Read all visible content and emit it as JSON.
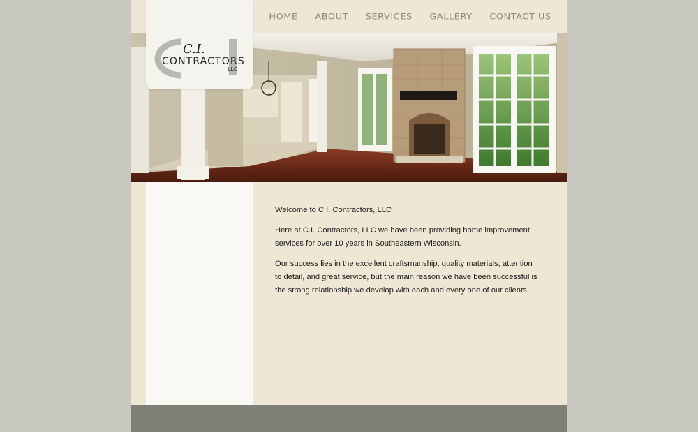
{
  "nav": {
    "items": [
      "HOME",
      "ABOUT",
      "SERVICES",
      "GALLERY",
      "CONTACT US"
    ]
  },
  "logo": {
    "line1": "C.I.",
    "line2": "CONTRACTORS",
    "line3": "LLC"
  },
  "content": {
    "heading": "Welcome to C.I. Contractors, LLC",
    "paragraph1": "Here at C.I. Contractors, LLC we have been providing home improvement services for over 10 years in Southeastern Wisconsin.",
    "paragraph2": "Our success lies in the excellent craftsmanship, quality materials, attention to detail, and great service, but the main reason we have been successful is the strong relationship we develop with each and every one of our clients."
  },
  "colors": {
    "page_bg": "#c8c7c0",
    "site_bg": "#efe7d6",
    "sidebar_bg": "#f8f8f4",
    "footer_bg": "#7f7f75",
    "nav_text": "#8a8a83"
  },
  "hero": {
    "image": "interior-room-photo"
  }
}
